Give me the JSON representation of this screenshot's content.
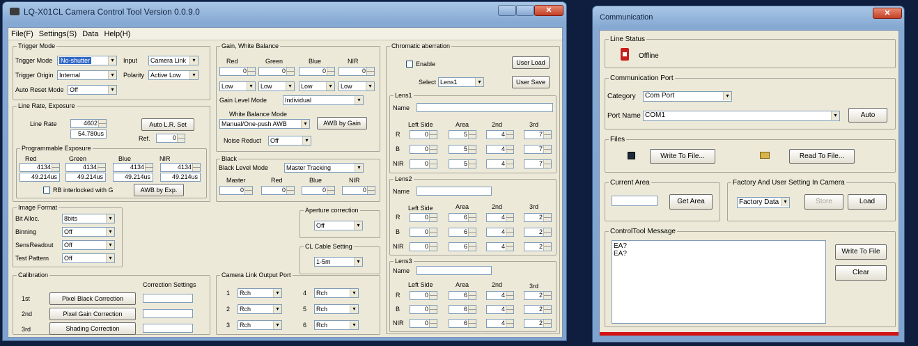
{
  "main_window": {
    "title": "LQ-X01CL Camera Control Tool   Version 0.0.9.0",
    "menu": [
      "File(F)",
      "Settings(S)",
      "Data",
      "Help(H)"
    ],
    "trigger_mode": {
      "group_title": "Trigger Mode",
      "trigger_mode_label": "Trigger Mode",
      "trigger_mode_value": "No-shutter",
      "input_label": "Input",
      "input_value": "Camera Link",
      "trigger_origin_label": "Trigger Origin",
      "trigger_origin_value": "Internal",
      "polarity_label": "Polarity",
      "polarity_value": "Active Low",
      "auto_reset_label": "Auto Reset Mode",
      "auto_reset_value": "Off"
    },
    "line_rate": {
      "group_title": "Line Rate, Exposure",
      "line_rate_label": "Line Rate",
      "line_rate_value": "4602",
      "line_rate_us": "54.780us",
      "auto_lr_button": "Auto L.R. Set",
      "ref_label": "Ref.",
      "ref_value": "0",
      "prog_title": "Programmable Exposure",
      "channels": [
        "Red",
        "Green",
        "Blue",
        "NIR"
      ],
      "values": [
        "4134",
        "4134",
        "4134",
        "4134"
      ],
      "us_values": [
        "49.214us",
        "49.214us",
        "49.214us",
        "49.214us"
      ],
      "rb_interlocked_label": "RB interlocked with G",
      "awb_exp_button": "AWB by Exp."
    },
    "image_format": {
      "group_title": "Image Format",
      "rows": [
        {
          "label": "Bit Alloc.",
          "value": "8bits"
        },
        {
          "label": "Binning",
          "value": "Off"
        },
        {
          "label": "SensReadout",
          "value": "Off"
        },
        {
          "label": "Test Pattern",
          "value": "Off"
        }
      ]
    },
    "calibration": {
      "group_title": "Calibration",
      "settings_label": "Correction Settings",
      "rows": [
        {
          "label": "1st",
          "button": "Pixel Black Correction"
        },
        {
          "label": "2nd",
          "button": "Pixel Gain Correction"
        },
        {
          "label": "3rd",
          "button": "Shading Correction"
        }
      ]
    },
    "gain_wb": {
      "group_title": "Gain, White Balance",
      "channels": [
        "Red",
        "Green",
        "Blue",
        "NIR"
      ],
      "values": [
        "0",
        "0",
        "0",
        "0"
      ],
      "levels": [
        "Low",
        "Low",
        "Low",
        "Low"
      ],
      "gain_level_mode_label": "Gain Level Mode",
      "gain_level_mode_value": "Individual",
      "wb_mode_label": "White Balance Mode",
      "wb_mode_value": "Manual/One-push AWB",
      "awb_gain_button": "AWB by Gain",
      "noise_reduct_label": "Noise Reduct",
      "noise_reduct_value": "Off"
    },
    "black": {
      "group_title": "Black",
      "black_level_mode_label": "Black Level Mode",
      "black_level_mode_value": "Master Tracking",
      "channels": [
        "Master",
        "Red",
        "Blue",
        "NIR"
      ],
      "values": [
        "0",
        "0",
        "0",
        "0"
      ]
    },
    "aperture": {
      "group_title": "Aperture correction",
      "value": "Off"
    },
    "cl_cable": {
      "group_title": "CL Cable Setting",
      "value": "1-5m"
    },
    "cl_output": {
      "group_title": "Camera Link Output Port",
      "ports": [
        {
          "num": "1",
          "value": "Rch"
        },
        {
          "num": "4",
          "value": "Rch"
        },
        {
          "num": "2",
          "value": "Rch"
        },
        {
          "num": "5",
          "value": "Rch"
        },
        {
          "num": "3",
          "value": "Rch"
        },
        {
          "num": "6",
          "value": "Rch"
        }
      ]
    },
    "chromatic": {
      "group_title": "Chromatic aberration",
      "enable_label": "Enable",
      "user_load_button": "User Load",
      "select_label": "Select",
      "select_value": "Lens1",
      "user_save_button": "User Save",
      "name_label": "Name",
      "col_headers": [
        "Left Side",
        "Area",
        "2nd",
        "3rd"
      ],
      "row_labels": [
        "R",
        "B",
        "NIR"
      ],
      "lenses": [
        {
          "title": "Lens1",
          "rows": [
            [
              "0",
              "5",
              "4",
              "7"
            ],
            [
              "0",
              "5",
              "4",
              "7"
            ],
            [
              "0",
              "5",
              "4",
              "7"
            ]
          ]
        },
        {
          "title": "Lens2",
          "rows": [
            [
              "0",
              "6",
              "4",
              "2"
            ],
            [
              "0",
              "6",
              "4",
              "2"
            ],
            [
              "0",
              "6",
              "4",
              "2"
            ]
          ]
        },
        {
          "title": "Lens3",
          "rows": [
            [
              "0",
              "6",
              "4",
              "2"
            ],
            [
              "0",
              "6",
              "4",
              "2"
            ],
            [
              "0",
              "6",
              "4",
              "2"
            ]
          ]
        }
      ]
    }
  },
  "comm_window": {
    "title": "Communication",
    "line_status_title": "Line Status",
    "line_status": "Offline",
    "comm_port_title": "Communication Port",
    "category_label": "Category",
    "category_value": "Com Port",
    "port_name_label": "Port Name",
    "port_name_value": "COM1",
    "auto_button": "Auto",
    "files_title": "Files",
    "write_file_button": "Write To File...",
    "read_file_button": "Read To File...",
    "current_area_title": "Current Area",
    "get_area_button": "Get Area",
    "factory_title": "Factory And User Setting In Camera",
    "factory_value": "Factory Data",
    "store_button": "Store",
    "load_button": "Load",
    "message_title": "ControlTool Message",
    "messages": "EA?\nEA?",
    "write_to_file_button": "Write To File",
    "clear_button": "Clear"
  }
}
